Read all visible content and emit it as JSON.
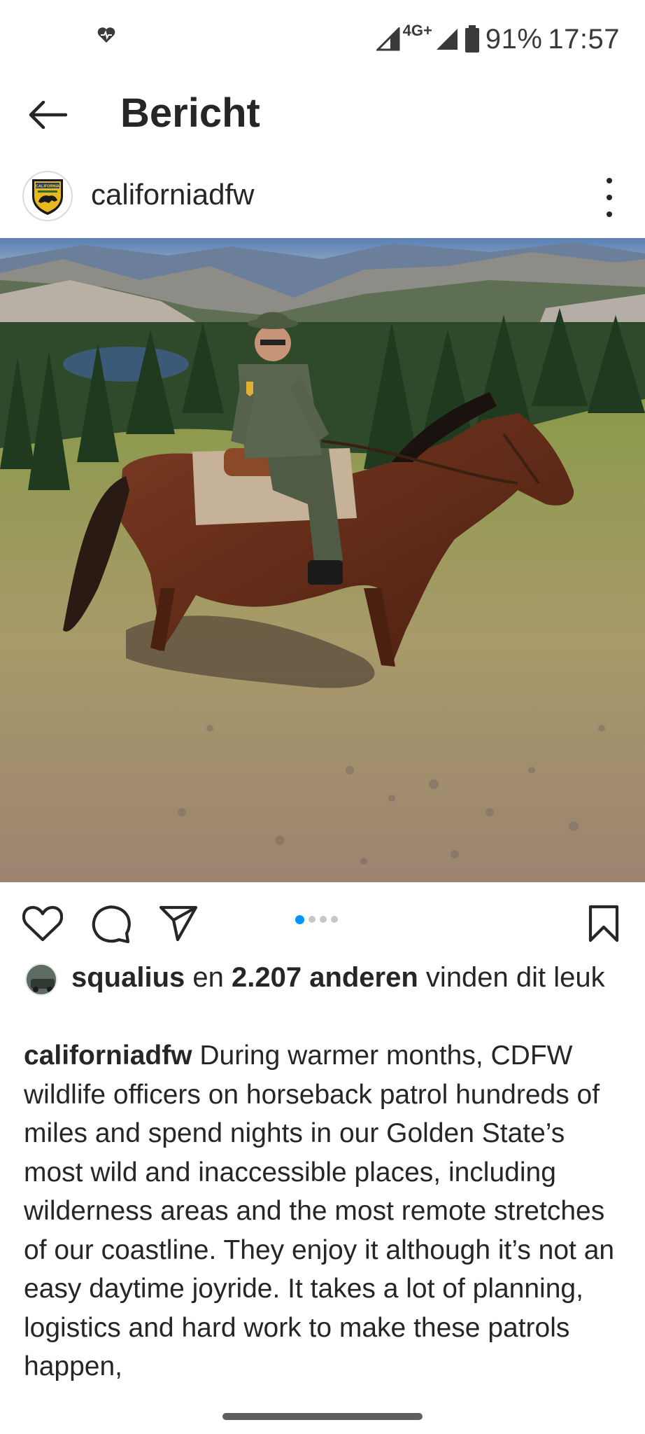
{
  "status_bar": {
    "network": "4G+",
    "battery": "91%",
    "time": "17:57"
  },
  "header": {
    "title": "Bericht"
  },
  "post": {
    "username": "californiadfw",
    "avatar_text": "CALIFORNIA",
    "carousel": {
      "count": 4,
      "active": 1
    },
    "likes": {
      "user": "squalius",
      "connector": " en ",
      "count_label": "2.207 anderen",
      "suffix": " vinden dit leuk"
    },
    "caption": {
      "username": "californiadfw",
      "text": " During warmer months, CDFW wildlife officers on horseback patrol hundreds of miles and spend nights in our Golden State’s most wild and inaccessible places, including wilderness areas and the most remote stretches of our coastline. They enjoy it although it’s not an easy daytime joyride. It takes a lot of planning, logistics and hard work to make these patrols happen,"
    }
  },
  "icons": {
    "status_left": "health-heart-icon",
    "signal": "signal-icon",
    "battery": "battery-icon",
    "back": "back-arrow-icon",
    "more": "more-vertical-icon",
    "like": "heart-icon",
    "comment": "comment-icon",
    "share": "send-icon",
    "save": "bookmark-icon"
  },
  "colors": {
    "text": "#262626",
    "accent_dot": "#0095f6",
    "inactive_dot": "#c7c7c7"
  }
}
